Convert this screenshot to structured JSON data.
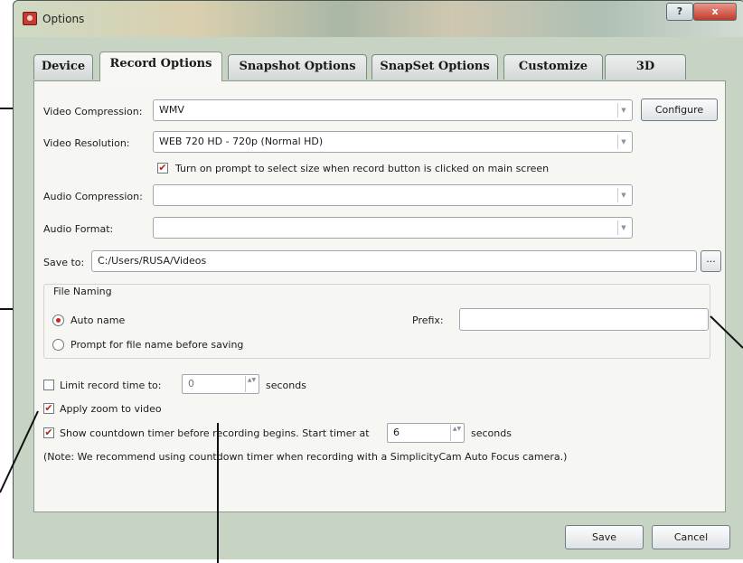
{
  "window": {
    "title": "Options",
    "help_glyph": "?",
    "close_glyph": "x"
  },
  "tabs": [
    {
      "label": "Device"
    },
    {
      "label": "Record Options"
    },
    {
      "label": "Snapshot Options"
    },
    {
      "label": "SnapSet Options"
    },
    {
      "label": "Customize"
    },
    {
      "label": "3D"
    }
  ],
  "form": {
    "video_compression": {
      "label": "Video Compression:",
      "value": "WMV"
    },
    "configure_label": "Configure",
    "video_resolution": {
      "label": "Video Resolution:",
      "value": "WEB 720 HD - 720p (Normal HD)"
    },
    "prompt_size": {
      "label": "Turn on prompt to select size when record button is clicked on main screen",
      "checked": true
    },
    "audio_compression": {
      "label": "Audio Compression:",
      "value": ""
    },
    "audio_format": {
      "label": "Audio Format:",
      "value": ""
    },
    "save_to": {
      "label": "Save to:",
      "value": "C:/Users/RUSA/Videos",
      "browse_label": "..."
    },
    "file_naming": {
      "title": "File Naming",
      "auto_name": {
        "label": "Auto name",
        "selected": true
      },
      "prompt_name": {
        "label": "Prompt for file name before saving",
        "selected": false
      },
      "prefix": {
        "label": "Prefix:",
        "value": ""
      }
    },
    "limit_record": {
      "label": "Limit record time to:",
      "value": "0",
      "unit": "seconds",
      "checked": false
    },
    "apply_zoom": {
      "label": "Apply zoom to video",
      "checked": true
    },
    "countdown": {
      "label": "Show countdown timer before recording begins. Start timer at",
      "value": "6",
      "unit": "seconds",
      "checked": true
    },
    "note": "(Note: We recommend using countdown timer when recording with a SimplicityCam Auto Focus camera.)"
  },
  "footer": {
    "save_label": "Save",
    "cancel_label": "Cancel"
  },
  "glyphs": {
    "check": "✔",
    "dropdown": "▼",
    "spin": "▲▼"
  }
}
